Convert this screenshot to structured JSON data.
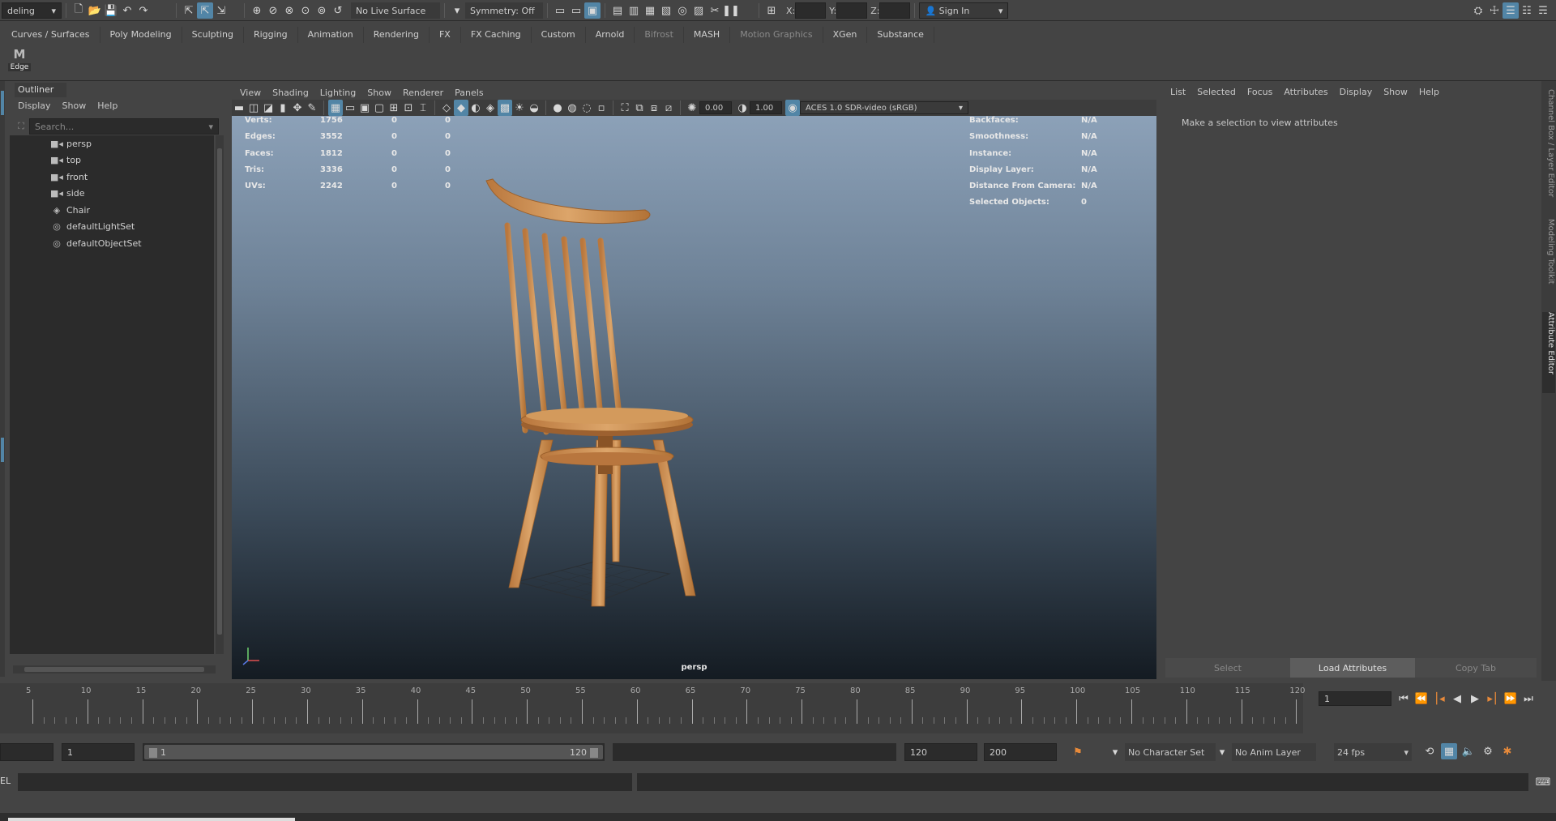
{
  "status_line": {
    "mode_menu": "deling",
    "live_surface": "No Live Surface",
    "symmetry": "Symmetry: Off",
    "x_label": "X:",
    "y_label": "Y:",
    "z_label": "Z:",
    "sign_in": "Sign In"
  },
  "shelf_tabs": [
    "Curves / Surfaces",
    "Poly Modeling",
    "Sculpting",
    "Rigging",
    "Animation",
    "Rendering",
    "FX",
    "FX Caching",
    "Custom",
    "Arnold",
    "Bifrost",
    "MASH",
    "Motion Graphics",
    "XGen",
    "Substance"
  ],
  "shelf": {
    "tool_label": "Edge"
  },
  "outliner": {
    "title": "Outliner",
    "menu": [
      "Display",
      "Show",
      "Help"
    ],
    "search_placeholder": "Search...",
    "items": [
      {
        "label": "persp",
        "icon": "camera-icon"
      },
      {
        "label": "top",
        "icon": "camera-icon"
      },
      {
        "label": "front",
        "icon": "camera-icon"
      },
      {
        "label": "side",
        "icon": "camera-icon"
      },
      {
        "label": "Chair",
        "icon": "transform-icon"
      },
      {
        "label": "defaultLightSet",
        "icon": "set-icon"
      },
      {
        "label": "defaultObjectSet",
        "icon": "set-icon"
      }
    ]
  },
  "viewport": {
    "menu": [
      "View",
      "Shading",
      "Lighting",
      "Show",
      "Renderer",
      "Panels"
    ],
    "exposure": "0.00",
    "gamma": "1.00",
    "color_space": "ACES 1.0 SDR-video (sRGB)",
    "camera_label": "persp",
    "stats": [
      {
        "k": "Verts:",
        "v": "1756",
        "a": "0",
        "b": "0"
      },
      {
        "k": "Edges:",
        "v": "3552",
        "a": "0",
        "b": "0"
      },
      {
        "k": "Faces:",
        "v": "1812",
        "a": "0",
        "b": "0"
      },
      {
        "k": "Tris:",
        "v": "3336",
        "a": "0",
        "b": "0"
      },
      {
        "k": "UVs:",
        "v": "2242",
        "a": "0",
        "b": "0"
      }
    ],
    "info": [
      {
        "k": "Backfaces:",
        "v": "N/A"
      },
      {
        "k": "Smoothness:",
        "v": "N/A"
      },
      {
        "k": "Instance:",
        "v": "N/A"
      },
      {
        "k": "Display Layer:",
        "v": "N/A"
      },
      {
        "k": "Distance From Camera:",
        "v": "N/A"
      },
      {
        "k": "Selected Objects:",
        "v": "0"
      }
    ]
  },
  "attribute_editor": {
    "menu": [
      "List",
      "Selected",
      "Focus",
      "Attributes",
      "Display",
      "Show",
      "Help"
    ],
    "message": "Make a selection to view attributes",
    "select_btn": "Select",
    "load_btn": "Load Attributes",
    "copy_btn": "Copy Tab",
    "side_tabs": [
      "Channel Box / Layer Editor",
      "Modeling Toolkit",
      "Attribute Editor"
    ]
  },
  "timeline": {
    "ticks": [
      "5",
      "10",
      "15",
      "20",
      "25",
      "30",
      "35",
      "40",
      "45",
      "50",
      "55",
      "60",
      "65",
      "70",
      "75",
      "80",
      "85",
      "90",
      "95",
      "100",
      "105",
      "110",
      "115",
      "120"
    ],
    "current_frame": "1"
  },
  "range": {
    "start": "1",
    "range_start": "1",
    "range_end": "120",
    "end": "120",
    "anim_end": "200",
    "character_set": "No Character Set",
    "anim_layer": "No Anim Layer",
    "fps": "24 fps"
  },
  "command_line": {
    "label": "EL"
  }
}
